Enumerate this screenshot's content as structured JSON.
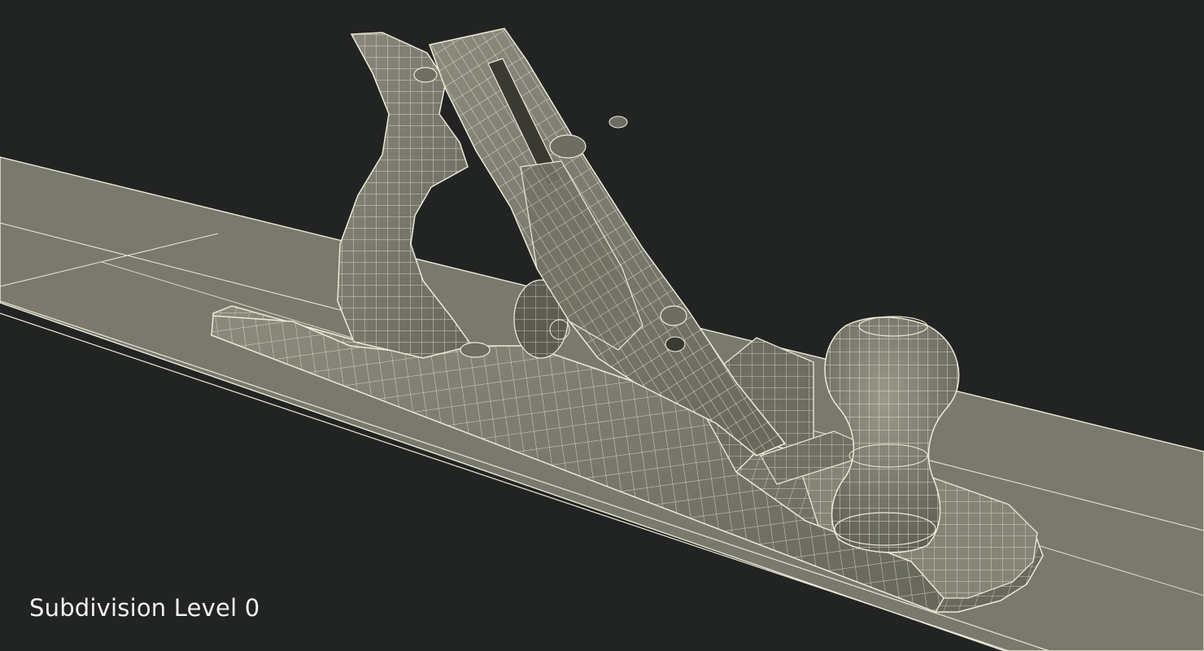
{
  "caption": {
    "text": "Subdivision Level 0"
  },
  "render": {
    "background_color": "#222323",
    "mesh_fill_color": "#7c7b6e",
    "mesh_shadow_color": "#5f5f54",
    "wire_color": "#ecebd8",
    "icons": [
      "hand-plane-wireframe"
    ]
  }
}
